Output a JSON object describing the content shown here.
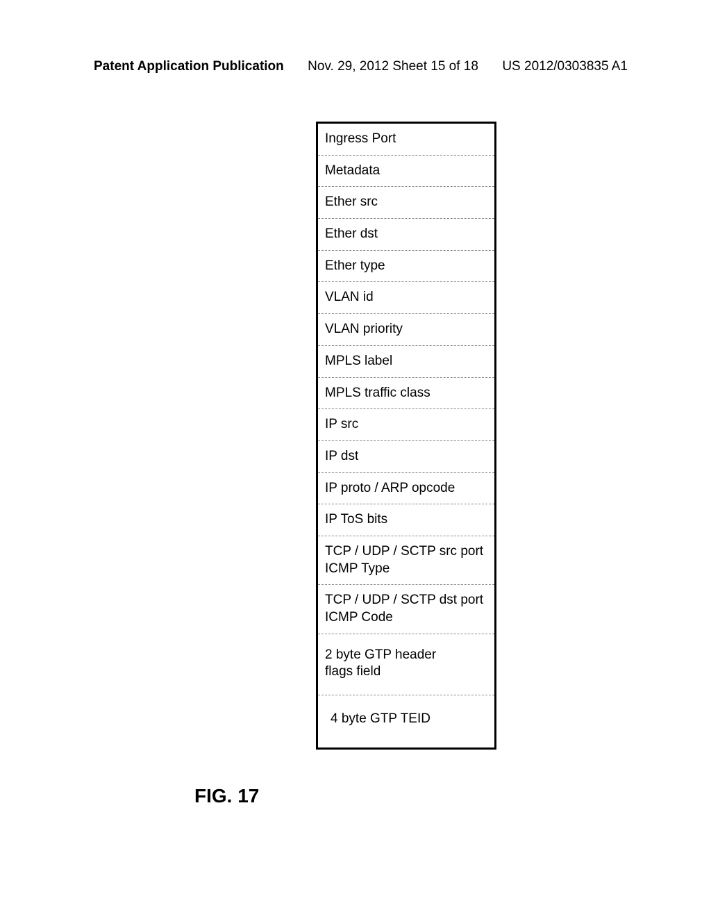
{
  "header": {
    "left": "Patent Application Publication",
    "center": "Nov. 29, 2012  Sheet 15 of 18",
    "right": "US 2012/0303835 A1"
  },
  "figure": {
    "label": "FIG. 17"
  },
  "table": {
    "rows": [
      "Ingress Port",
      "Metadata",
      "Ether src",
      "Ether dst",
      "Ether type",
      "VLAN id",
      "VLAN priority",
      "MPLS label",
      "MPLS traffic class",
      "IP src",
      "IP dst",
      "IP proto / ARP opcode",
      "IP ToS bits"
    ],
    "doubleRows": [
      {
        "line1": "TCP / UDP / SCTP src port",
        "line2": "ICMP Type"
      },
      {
        "line1": "TCP / UDP / SCTP dst port",
        "line2": "ICMP Code"
      },
      {
        "line1": "2 byte GTP header",
        "line2": "flags field"
      }
    ],
    "lastRow": "4 byte GTP TEID"
  }
}
